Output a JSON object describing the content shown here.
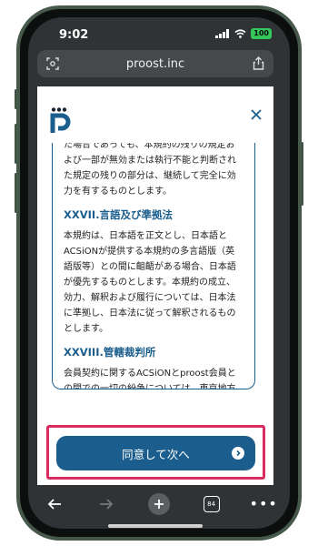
{
  "status": {
    "time": "9:02",
    "battery": "100"
  },
  "browser": {
    "url": "proost.inc",
    "tab_count": "84"
  },
  "modal": {
    "paragraphs": [
      "た場合であっても、本規約の残りの規定および一部が無効または執行不能と判断された規定の残りの部分は、継続して完全に効力を有するものとします。",
      "本規約は、日本語を正文とし、日本語とACSiONが提供する本規約の多言語版（英語版等）との間に齟齬がある場合、日本語が優先するものとします。本規約の成立、効力、解釈および履行については、日本法に準拠し、日本法に従って解釈されるものとします。",
      "会員契約に関するACSiONとproost会員との間での一切の紛争については、東京地方裁判所を第一審の専属的合意管轄裁判所とします。"
    ],
    "headings": [
      "XXVII.言語及び準拠法",
      "XXVIII.管轄裁判所"
    ],
    "agree_button": "同意して次へ"
  },
  "colors": {
    "accent": "#1b5e8e",
    "highlight": "#d92b60"
  }
}
